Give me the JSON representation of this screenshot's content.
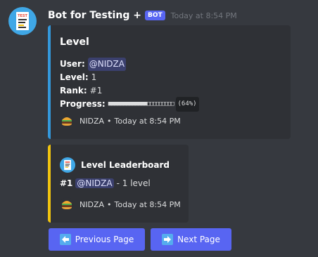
{
  "message": {
    "author": "Bot for Testing +",
    "bot_tag": "BOT",
    "timestamp": "Today at 8:54 PM",
    "avatar_text": "TEST"
  },
  "embed_level": {
    "title": "Level",
    "accent_color": "#3498db",
    "user_label": "User:",
    "user_value": "@NIDZA",
    "level_label": "Level:",
    "level_value": "1",
    "rank_label": "Rank:",
    "rank_value": "#1",
    "progress_label": "Progress:",
    "progress_bar": "■■■■■■■■■■■■■□□□□□□□□□",
    "progress_percent": "(64%)",
    "progress_fraction": 0.64,
    "footer_name": "NIDZA",
    "footer_separator": "•",
    "footer_time": "Today at 8:54 PM",
    "footer_icon": "burger-icon"
  },
  "embed_leaderboard": {
    "accent_color": "#f1c40f",
    "author_name": "Level Leaderboard",
    "rank": "#1",
    "user": "@NIDZA",
    "detail": "- 1 level",
    "footer_name": "NIDZA",
    "footer_separator": "•",
    "footer_time": "Today at 8:54 PM"
  },
  "buttons": {
    "prev_label": "Previous Page",
    "next_label": "Next Page",
    "prev_icon": "left-arrow-icon",
    "next_icon": "right-arrow-icon",
    "color": "#5865f2"
  }
}
